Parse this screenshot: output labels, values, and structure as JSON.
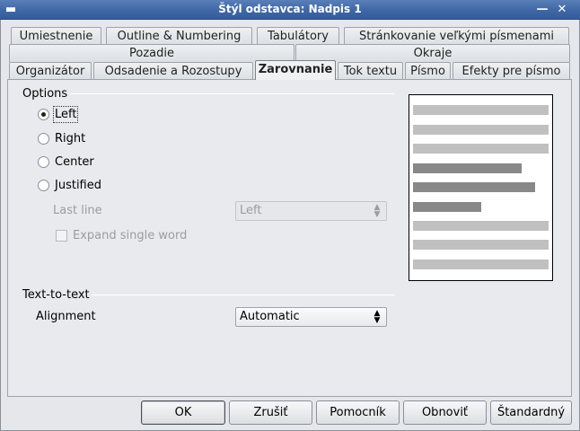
{
  "window": {
    "title": "Štýl odstavca: Nadpis 1"
  },
  "tabs": {
    "row1": [
      "Umiestnenie",
      "Outline & Numbering",
      "Tabulátory",
      "Stránkovanie veľkými písmenami"
    ],
    "row2": [
      "Pozadie",
      "Okraje"
    ],
    "row3": [
      "Organizátor",
      "Odsadenie a Rozostupy",
      "Zarovnanie",
      "Tok textu",
      "Písmo",
      "Efekty pre písmo"
    ],
    "active": "Zarovnanie"
  },
  "options": {
    "group_label": "Options",
    "radios": [
      {
        "label": "Left",
        "selected": true
      },
      {
        "label": "Right",
        "selected": false
      },
      {
        "label": "Center",
        "selected": false
      },
      {
        "label": "Justified",
        "selected": false
      }
    ],
    "last_line_label": "Last line",
    "last_line_value": "Left",
    "expand_label": "Expand single word",
    "expand_checked": false
  },
  "text_to_text": {
    "group_label": "Text-to-text",
    "alignment_label": "Alignment",
    "alignment_value": "Automatic"
  },
  "buttons": {
    "ok": "OK",
    "cancel": "Zrušiť",
    "help": "Pomocník",
    "reset": "Obnoviť",
    "standard": "Štandardný"
  },
  "colors": {
    "title_bar": "#3f67a6",
    "preview_light": "#c0c0c0",
    "preview_dark": "#888888"
  }
}
